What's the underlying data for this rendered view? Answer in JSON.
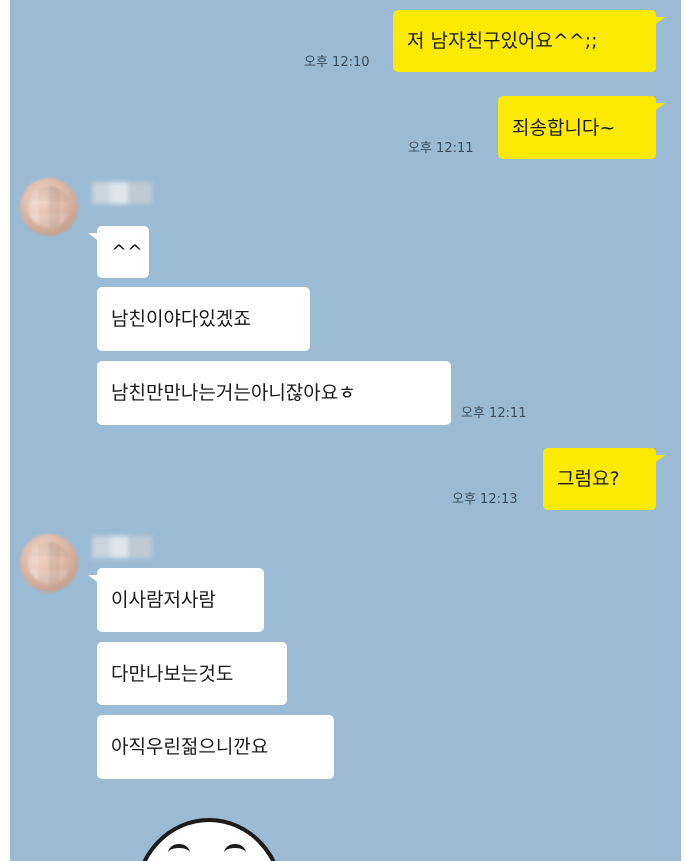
{
  "messages": {
    "m1": {
      "text": "저 남자친구있어요^^;;",
      "time": "오후 12:10"
    },
    "m2": {
      "text": "죄송합니다~",
      "time": "오후 12:11"
    },
    "m3": {
      "text": "^^"
    },
    "m4": {
      "text": "남친이야다있겠죠"
    },
    "m5": {
      "text": "남친만만나는거는아니잖아요ㅎ",
      "time": "오후 12:11"
    },
    "m6": {
      "text": "그럼요?",
      "time": "오후 12:13"
    },
    "m7": {
      "text": "이사람저사람"
    },
    "m8": {
      "text": "다만나보는것도"
    },
    "m9": {
      "text": "아직우린젊으니깐요"
    }
  },
  "colors": {
    "background": "#9bbbd4",
    "outgoing_bubble": "#fdea02",
    "incoming_bubble": "#ffffff"
  }
}
